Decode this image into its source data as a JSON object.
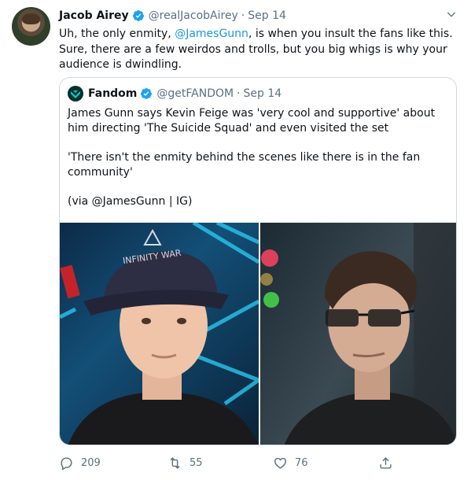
{
  "tweet": {
    "author_name": "Jacob Airey",
    "handle": "@realJacobAirey",
    "separator": "·",
    "date": "Sep 14",
    "text_before": "Uh, the only enmity, ",
    "mention": "@JamesGunn",
    "text_after": ", is when you insult the fans like this. Sure, there are a few weirdos and trolls, but you big whigs is why your audience is dwindling."
  },
  "quoted": {
    "author_name": "Fandom",
    "handle": "@getFANDOM",
    "separator": "·",
    "date": "Sep 14",
    "para1": "James Gunn says Kevin Feige was 'very cool and supportive' about him directing 'The Suicide Squad' and even visited the set",
    "para2": "'There isn't the enmity behind the scenes like there is in the fan community'",
    "para3": "(via @JamesGunn | IG)",
    "cap_text": "INFINITY WAR"
  },
  "actions": {
    "replies": "209",
    "retweets": "55",
    "likes": "76"
  },
  "colors": {
    "link": "#1b95e0",
    "muted": "#5b7083",
    "verified": "#1da1f2",
    "border": "#cfd9de"
  },
  "icons": [
    "verified-badge-icon",
    "chevron-down-icon",
    "fandom-logo-icon",
    "reply-icon",
    "retweet-icon",
    "like-icon",
    "share-icon"
  ]
}
